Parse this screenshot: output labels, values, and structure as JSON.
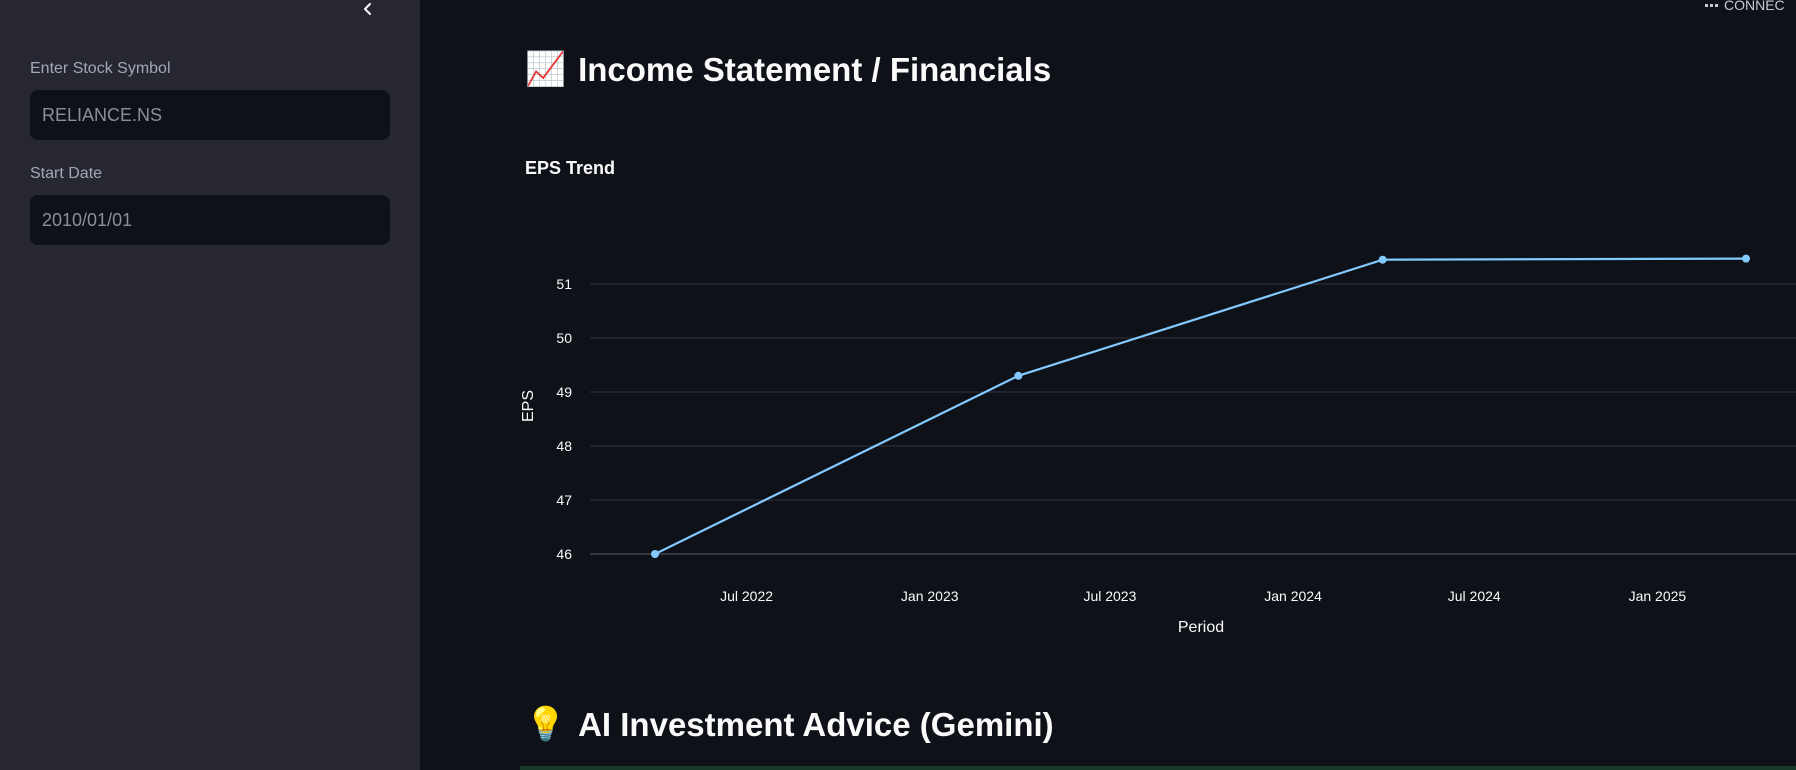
{
  "sidebar": {
    "symbol_label": "Enter Stock Symbol",
    "symbol_value": "RELIANCE.NS",
    "start_label": "Start Date",
    "start_value": "2010/01/01"
  },
  "status": {
    "text": "CONNEC"
  },
  "sections": {
    "financials_icon": "📈",
    "financials_title": "Income Statement / Financials",
    "advice_icon": "💡",
    "advice_title": "AI Investment Advice (Gemini)"
  },
  "colors": {
    "line": "#83c9ff",
    "grid": "#31333f",
    "accent_bar": "#173928"
  },
  "chart_data": {
    "type": "line",
    "title": "EPS Trend",
    "xlabel": "Period",
    "ylabel": "EPS",
    "x": [
      "2022-03-31",
      "2023-03-31",
      "2024-03-31",
      "2025-03-31"
    ],
    "values": [
      46.0,
      49.3,
      51.45,
      51.47
    ],
    "y_ticks": [
      46,
      47,
      48,
      49,
      50,
      51
    ],
    "x_ticks": [
      {
        "date": "2022-07-01",
        "label": "Jul 2022"
      },
      {
        "date": "2023-01-01",
        "label": "Jan 2023"
      },
      {
        "date": "2023-07-01",
        "label": "Jul 2023"
      },
      {
        "date": "2024-01-01",
        "label": "Jan 2024"
      },
      {
        "date": "2024-07-01",
        "label": "Jul 2024"
      },
      {
        "date": "2025-01-01",
        "label": "Jan 2025"
      }
    ],
    "grid": true
  }
}
